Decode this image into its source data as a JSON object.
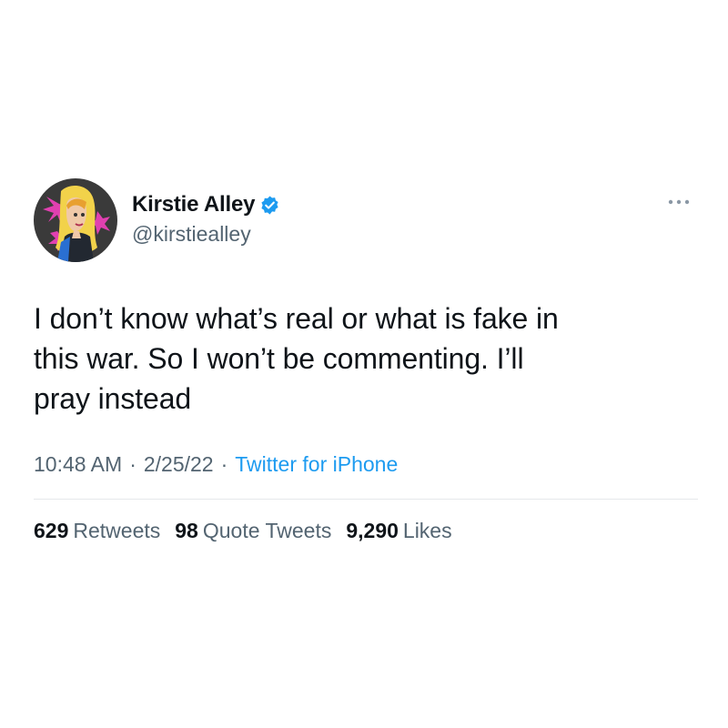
{
  "author": {
    "display_name": "Kirstie Alley",
    "handle": "@kirstiealley",
    "verified": true,
    "avatar_icon": "profile-portrait-pop-art"
  },
  "tweet": {
    "text": "I don’t know what’s real or what is fake in\nthis war. So I won’t be commenting. I’ll\npray instead",
    "time": "10:48 AM",
    "date": "2/25/22",
    "separator": "·",
    "source": "Twitter for iPhone"
  },
  "stats": {
    "retweets_count": "629",
    "retweets_label": "Retweets",
    "quotes_count": "98",
    "quotes_label": "Quote Tweets",
    "likes_count": "9,290",
    "likes_label": "Likes"
  },
  "colors": {
    "text": "#0f1419",
    "secondary": "#536471",
    "accent": "#1d9bf0"
  }
}
